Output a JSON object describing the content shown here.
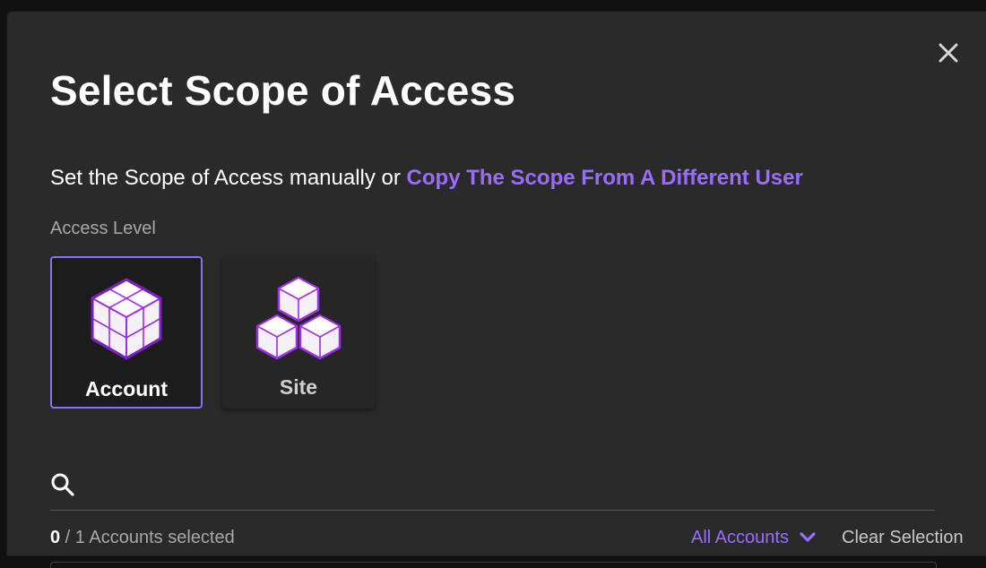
{
  "dialog": {
    "title": "Select Scope of Access",
    "close_icon": "close-icon"
  },
  "subtitle": {
    "text": "Set the Scope of Access manually or ",
    "link": "Copy The Scope From A Different User"
  },
  "access_level": {
    "label": "Access Level",
    "options": [
      {
        "label": "Account",
        "icon": "account-cubes-icon",
        "selected": true
      },
      {
        "label": "Site",
        "icon": "site-cubes-icon",
        "selected": false
      }
    ]
  },
  "search": {
    "icon": "search-icon",
    "placeholder": "",
    "value": ""
  },
  "selection": {
    "selected": "0",
    "rest": " / 1 Accounts selected"
  },
  "filter": {
    "label": "All Accounts",
    "icon": "chevron-down-icon"
  },
  "clear_label": "Clear Selection",
  "colors": {
    "accent": "#9b6cff",
    "modal_bg": "#2a2a2b",
    "selected_border": "#8f6ef7",
    "cube_stroke": "#a12ce8"
  }
}
